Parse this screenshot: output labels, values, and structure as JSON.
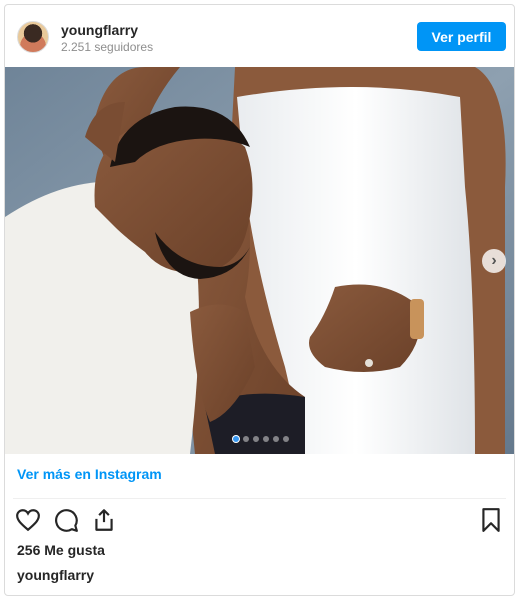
{
  "header": {
    "username": "youngflarry",
    "followers": "2.251 seguidores",
    "profile_button": "Ver perfil"
  },
  "carousel": {
    "total_slides": 6,
    "current_slide": 1
  },
  "more_link": "Ver más en Instagram",
  "actions": {
    "icons": [
      "heart-icon",
      "comment-icon",
      "share-icon",
      "bookmark-icon"
    ]
  },
  "likes": "256 Me gusta",
  "caption_user": "youngflarry",
  "colors": {
    "accent": "#0095f6",
    "text": "#262626",
    "muted": "#8e8e8e"
  }
}
